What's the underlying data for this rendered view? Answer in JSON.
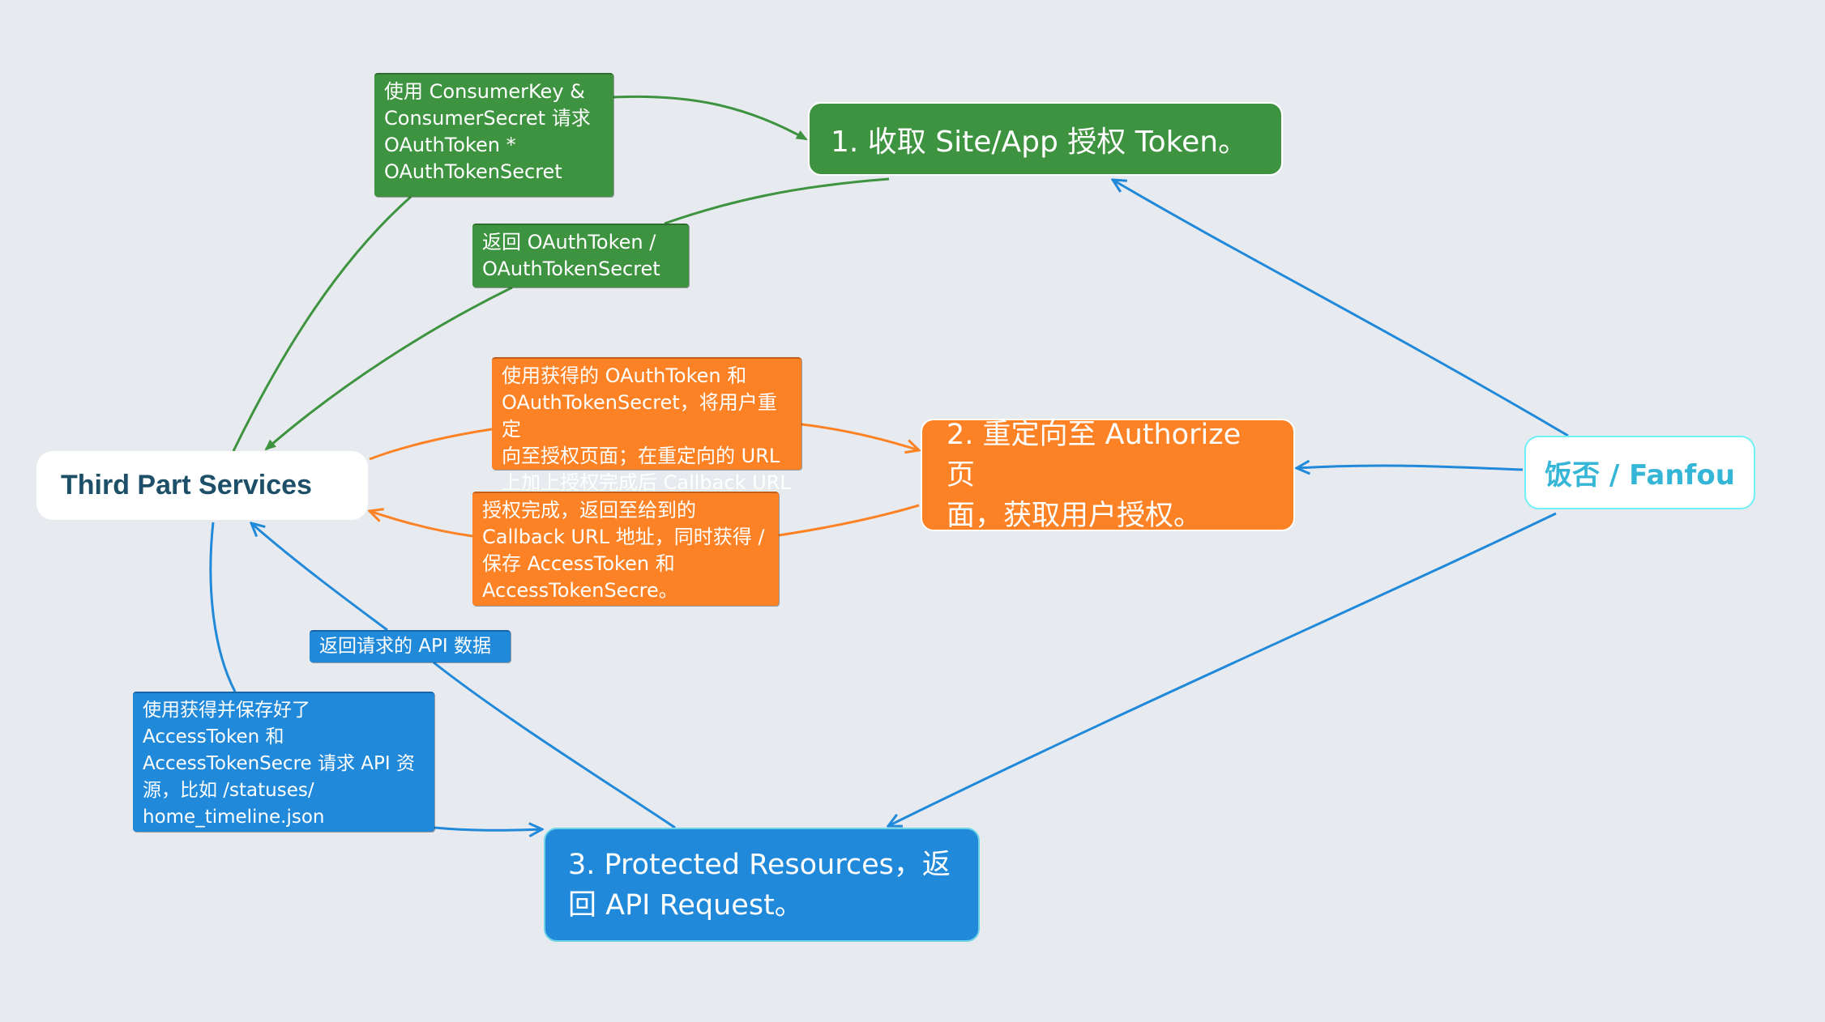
{
  "colors": {
    "background": "#e7eaee",
    "green": "#3e9340",
    "orange": "#fd8225",
    "blue": "#2189da",
    "cyan_border": "#6ff0f6",
    "dark_text": "#1d5068",
    "fanfou_text": "#35b6d6"
  },
  "nodes": {
    "third_party": "Third Part Services",
    "fanfou": "饭否 / Fanfou",
    "step1": "1. 收取 Site/App 授权 Token。",
    "step2_line1": "2. 重定向至 Authorize 页",
    "step2_line2": "面，获取用户授权。",
    "step3_line1": "3. Protected Resources，返",
    "step3_line2": "回 API Request。"
  },
  "labels": {
    "request_token": "使用 ConsumerKey &\nConsumerSecret 请求\nOAuthToken *\nOAuthTokenSecret",
    "return_token": "返回 OAuthToken /\nOAuthTokenSecret",
    "redirect_user": "使用获得的 OAuthToken 和\nOAuthTokenSecret，将用户重定\n向至授权页面；在重定向的 URL\n上加上授权完成后 Callback URL",
    "authorized_callback": "授权完成，返回至给到的\nCallback URL 地址，同时获得 /\n保存 AccessToken 和\nAccessTokenSecre。",
    "return_api_data": "返回请求的 API 数据",
    "request_api": "使用获得并保存好了\nAccessToken 和\nAccessTokenSecre 请求 API 资\n源，比如 /statuses/\nhome_timeline.json"
  },
  "edges": [
    {
      "from": "third_party",
      "to": "step1",
      "via": "request_token",
      "color": "green",
      "arrow": "filled"
    },
    {
      "from": "step1",
      "to": "third_party",
      "via": "return_token",
      "color": "green",
      "arrow": "filled"
    },
    {
      "from": "third_party",
      "to": "step2",
      "via": "redirect_user",
      "color": "orange",
      "arrow": "open"
    },
    {
      "from": "step2",
      "to": "third_party",
      "via": "authorized_callback",
      "color": "orange",
      "arrow": "open"
    },
    {
      "from": "third_party",
      "to": "step3",
      "via": "request_api",
      "color": "blue",
      "arrow": "open"
    },
    {
      "from": "step3",
      "to": "third_party",
      "via": "return_api_data",
      "color": "blue",
      "arrow": "open"
    },
    {
      "from": "fanfou",
      "to": "step1",
      "color": "blue",
      "arrow": "open"
    },
    {
      "from": "fanfou",
      "to": "step2",
      "color": "blue",
      "arrow": "open"
    },
    {
      "from": "fanfou",
      "to": "step3",
      "color": "blue",
      "arrow": "open"
    }
  ]
}
